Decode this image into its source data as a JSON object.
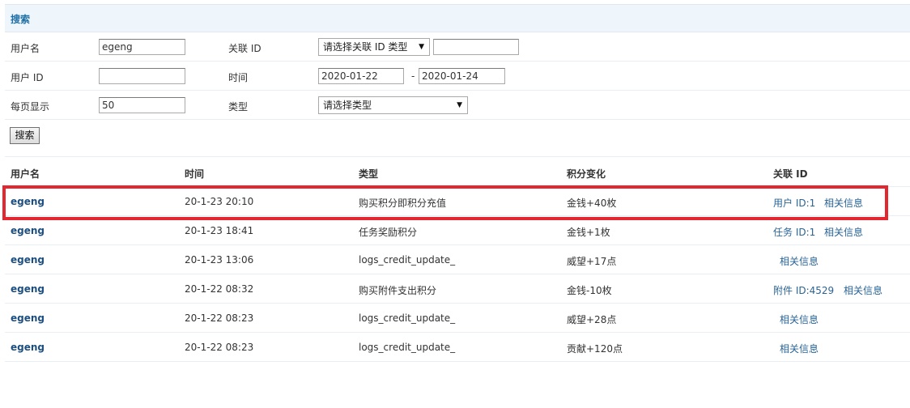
{
  "search": {
    "title": "搜索",
    "username_label": "用户名",
    "username_value": "egeng",
    "relid_label": "关联 ID",
    "relid_select": "请选择关联 ID 类型",
    "relid_value": "",
    "userid_label": "用户 ID",
    "userid_value": "",
    "time_label": "时间",
    "time_from": "2020-01-22",
    "time_sep": "-",
    "time_to": "2020-01-24",
    "perpage_label": "每页显示",
    "perpage_value": "50",
    "type_label": "类型",
    "type_select": "请选择类型",
    "submit_label": "搜索"
  },
  "table": {
    "headers": [
      "用户名",
      "时间",
      "类型",
      "积分变化",
      "关联 ID"
    ],
    "rows": [
      {
        "user": "egeng",
        "time": "20-1-23 20:10",
        "type": "购买积分即积分充值",
        "change": "金钱+40枚",
        "rel_id": "用户 ID:1",
        "info": "相关信息"
      },
      {
        "user": "egeng",
        "time": "20-1-23 18:41",
        "type": "任务奖励积分",
        "change": "金钱+1枚",
        "rel_id": "任务 ID:1",
        "info": "相关信息"
      },
      {
        "user": "egeng",
        "time": "20-1-23 13:06",
        "type": "logs_credit_update_",
        "change": "威望+17点",
        "rel_id": "",
        "info": "相关信息"
      },
      {
        "user": "egeng",
        "time": "20-1-22 08:32",
        "type": "购买附件支出积分",
        "change": "金钱-10枚",
        "rel_id": "附件 ID:4529",
        "info": "相关信息"
      },
      {
        "user": "egeng",
        "time": "20-1-22 08:23",
        "type": "logs_credit_update_",
        "change": "威望+28点",
        "rel_id": "",
        "info": "相关信息"
      },
      {
        "user": "egeng",
        "time": "20-1-22 08:23",
        "type": "logs_credit_update_",
        "change": "贡献+120点",
        "rel_id": "",
        "info": "相关信息"
      }
    ]
  },
  "colors": {
    "highlight": "#e3262f",
    "link": "#1d4f80",
    "header_bg": "#eef5fb"
  }
}
